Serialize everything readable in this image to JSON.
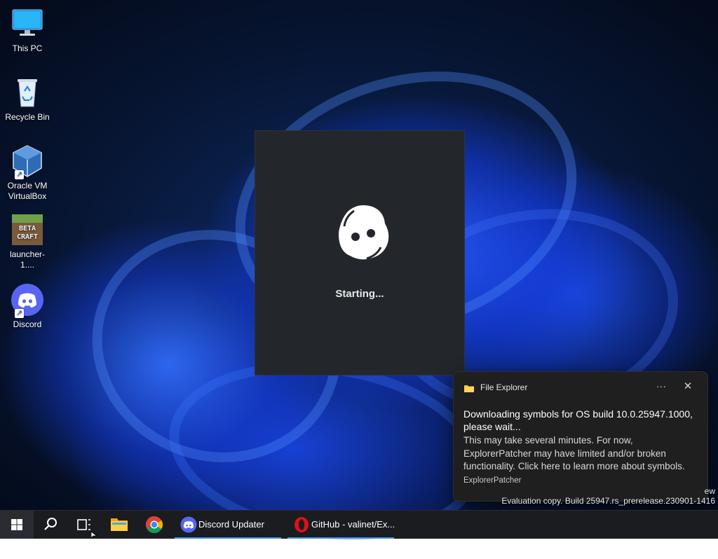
{
  "desktop": {
    "icons": [
      {
        "label": "This PC",
        "icon": "monitor-icon"
      },
      {
        "label": "Recycle Bin",
        "icon": "recycle-bin-icon"
      },
      {
        "label": "Oracle VM VirtualBox",
        "icon": "virtualbox-icon"
      },
      {
        "label": "launcher-1....",
        "icon": "betacraft-icon",
        "badge": "BETA\nCRAFT"
      },
      {
        "label": "Discord",
        "icon": "discord-icon"
      }
    ]
  },
  "discord_splash": {
    "status": "Starting..."
  },
  "toast": {
    "app": "File Explorer",
    "more": "···",
    "close": "✕",
    "title": "Downloading symbols for OS build 10.0.25947.1000, please wait...",
    "body": "This may take several minutes. For now, ExplorerPatcher may have limited and/or broken functionality. Click here to learn more about symbols.",
    "attribution": "ExplorerPatcher"
  },
  "watermark": {
    "line1": "ew",
    "line2": "Evaluation copy. Build 25947.rs_prerelease.230901-1416"
  },
  "taskbar": {
    "apps": [
      {
        "label": "Discord Updater",
        "icon": "discord-icon",
        "active": true
      },
      {
        "label": "GitHub - valinet/Ex...",
        "icon": "opera-icon",
        "active": true
      }
    ],
    "colors": {
      "accent": "#3f8ee8",
      "background": "#1b1c20"
    }
  }
}
